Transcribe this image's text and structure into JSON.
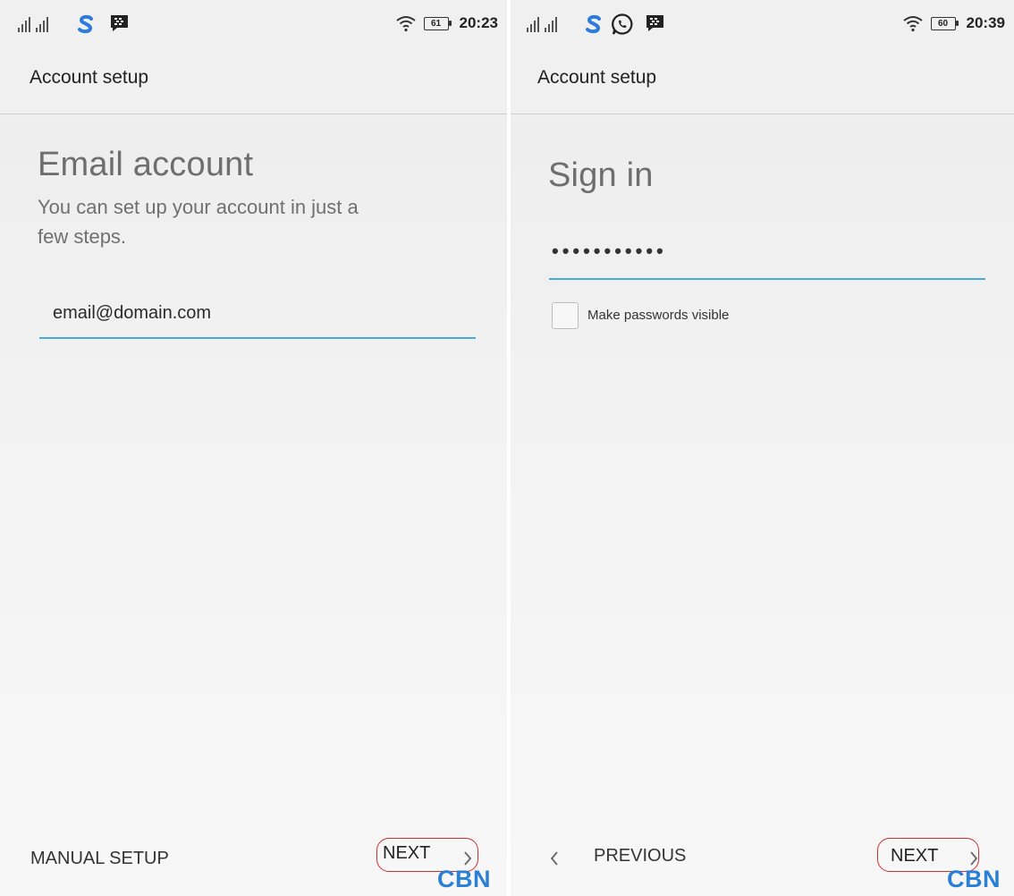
{
  "left": {
    "status": {
      "battery": "61",
      "time": "20:23"
    },
    "appbar_title": "Account setup",
    "heading": "Email account",
    "subtext_line1": "You can set up your account in just a",
    "subtext_line2": "few steps.",
    "email_value": "email@domain.com",
    "manual_setup_label": "MANUAL SETUP",
    "next_label": "NEXT",
    "watermark": "CBN"
  },
  "right": {
    "status": {
      "battery": "60",
      "time": "20:39"
    },
    "appbar_title": "Account setup",
    "heading": "Sign in",
    "password_value": "•••••••••••",
    "checkbox_label": "Make passwords visible",
    "previous_label": "PREVIOUS",
    "next_label": "NEXT",
    "watermark": "CBN"
  },
  "colors": {
    "accent": "#4aa9dc",
    "annotation_red": "#d02f2f",
    "watermark_blue": "#2a7fd6",
    "app_s_icon": "#2e7be0",
    "whatsapp_icon": "#222222"
  },
  "icons": [
    "signal-icon",
    "app-s-icon",
    "bbm-icon",
    "whatsapp-icon",
    "wifi-icon",
    "battery-icon",
    "chevron-left-icon",
    "chevron-right-icon"
  ]
}
